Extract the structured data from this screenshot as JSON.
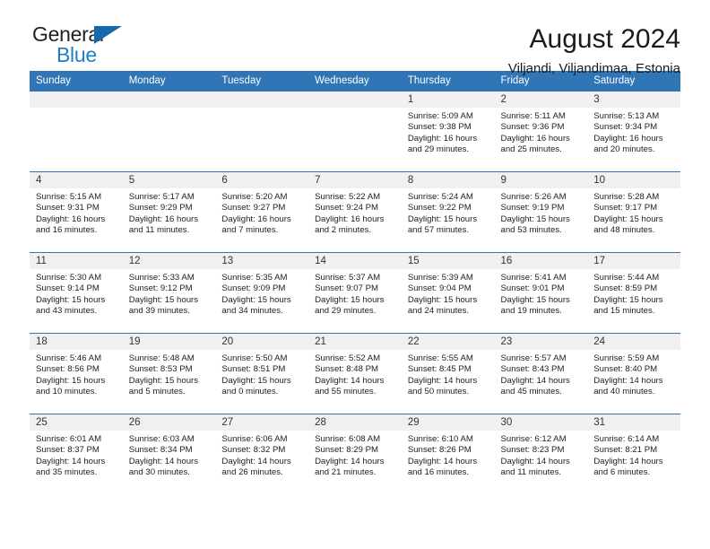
{
  "brand": {
    "name_dark": "General",
    "name_blue": "Blue",
    "accent_color": "#1f7fc6",
    "triangle_color": "#1668ad"
  },
  "header": {
    "title": "August 2024",
    "subtitle": "Viljandi, Viljandimaa, Estonia",
    "header_bg": "#3075b5",
    "daynum_bg": "#f0f0f0"
  },
  "weekday_headers": [
    "Sunday",
    "Monday",
    "Tuesday",
    "Wednesday",
    "Thursday",
    "Friday",
    "Saturday"
  ],
  "labels": {
    "sunrise": "Sunrise:",
    "sunset": "Sunset:",
    "daylight": "Daylight:"
  },
  "weeks": [
    [
      {
        "day": "",
        "empty": true,
        "sunrise": "",
        "sunset": "",
        "daylight1": "",
        "daylight2": ""
      },
      {
        "day": "",
        "empty": true,
        "sunrise": "",
        "sunset": "",
        "daylight1": "",
        "daylight2": ""
      },
      {
        "day": "",
        "empty": true,
        "sunrise": "",
        "sunset": "",
        "daylight1": "",
        "daylight2": ""
      },
      {
        "day": "",
        "empty": true,
        "sunrise": "",
        "sunset": "",
        "daylight1": "",
        "daylight2": ""
      },
      {
        "day": "1",
        "sunrise": "Sunrise: 5:09 AM",
        "sunset": "Sunset: 9:38 PM",
        "daylight1": "Daylight: 16 hours",
        "daylight2": "and 29 minutes."
      },
      {
        "day": "2",
        "sunrise": "Sunrise: 5:11 AM",
        "sunset": "Sunset: 9:36 PM",
        "daylight1": "Daylight: 16 hours",
        "daylight2": "and 25 minutes."
      },
      {
        "day": "3",
        "sunrise": "Sunrise: 5:13 AM",
        "sunset": "Sunset: 9:34 PM",
        "daylight1": "Daylight: 16 hours",
        "daylight2": "and 20 minutes."
      }
    ],
    [
      {
        "day": "4",
        "sunrise": "Sunrise: 5:15 AM",
        "sunset": "Sunset: 9:31 PM",
        "daylight1": "Daylight: 16 hours",
        "daylight2": "and 16 minutes."
      },
      {
        "day": "5",
        "sunrise": "Sunrise: 5:17 AM",
        "sunset": "Sunset: 9:29 PM",
        "daylight1": "Daylight: 16 hours",
        "daylight2": "and 11 minutes."
      },
      {
        "day": "6",
        "sunrise": "Sunrise: 5:20 AM",
        "sunset": "Sunset: 9:27 PM",
        "daylight1": "Daylight: 16 hours",
        "daylight2": "and 7 minutes."
      },
      {
        "day": "7",
        "sunrise": "Sunrise: 5:22 AM",
        "sunset": "Sunset: 9:24 PM",
        "daylight1": "Daylight: 16 hours",
        "daylight2": "and 2 minutes."
      },
      {
        "day": "8",
        "sunrise": "Sunrise: 5:24 AM",
        "sunset": "Sunset: 9:22 PM",
        "daylight1": "Daylight: 15 hours",
        "daylight2": "and 57 minutes."
      },
      {
        "day": "9",
        "sunrise": "Sunrise: 5:26 AM",
        "sunset": "Sunset: 9:19 PM",
        "daylight1": "Daylight: 15 hours",
        "daylight2": "and 53 minutes."
      },
      {
        "day": "10",
        "sunrise": "Sunrise: 5:28 AM",
        "sunset": "Sunset: 9:17 PM",
        "daylight1": "Daylight: 15 hours",
        "daylight2": "and 48 minutes."
      }
    ],
    [
      {
        "day": "11",
        "sunrise": "Sunrise: 5:30 AM",
        "sunset": "Sunset: 9:14 PM",
        "daylight1": "Daylight: 15 hours",
        "daylight2": "and 43 minutes."
      },
      {
        "day": "12",
        "sunrise": "Sunrise: 5:33 AM",
        "sunset": "Sunset: 9:12 PM",
        "daylight1": "Daylight: 15 hours",
        "daylight2": "and 39 minutes."
      },
      {
        "day": "13",
        "sunrise": "Sunrise: 5:35 AM",
        "sunset": "Sunset: 9:09 PM",
        "daylight1": "Daylight: 15 hours",
        "daylight2": "and 34 minutes."
      },
      {
        "day": "14",
        "sunrise": "Sunrise: 5:37 AM",
        "sunset": "Sunset: 9:07 PM",
        "daylight1": "Daylight: 15 hours",
        "daylight2": "and 29 minutes."
      },
      {
        "day": "15",
        "sunrise": "Sunrise: 5:39 AM",
        "sunset": "Sunset: 9:04 PM",
        "daylight1": "Daylight: 15 hours",
        "daylight2": "and 24 minutes."
      },
      {
        "day": "16",
        "sunrise": "Sunrise: 5:41 AM",
        "sunset": "Sunset: 9:01 PM",
        "daylight1": "Daylight: 15 hours",
        "daylight2": "and 19 minutes."
      },
      {
        "day": "17",
        "sunrise": "Sunrise: 5:44 AM",
        "sunset": "Sunset: 8:59 PM",
        "daylight1": "Daylight: 15 hours",
        "daylight2": "and 15 minutes."
      }
    ],
    [
      {
        "day": "18",
        "sunrise": "Sunrise: 5:46 AM",
        "sunset": "Sunset: 8:56 PM",
        "daylight1": "Daylight: 15 hours",
        "daylight2": "and 10 minutes."
      },
      {
        "day": "19",
        "sunrise": "Sunrise: 5:48 AM",
        "sunset": "Sunset: 8:53 PM",
        "daylight1": "Daylight: 15 hours",
        "daylight2": "and 5 minutes."
      },
      {
        "day": "20",
        "sunrise": "Sunrise: 5:50 AM",
        "sunset": "Sunset: 8:51 PM",
        "daylight1": "Daylight: 15 hours",
        "daylight2": "and 0 minutes."
      },
      {
        "day": "21",
        "sunrise": "Sunrise: 5:52 AM",
        "sunset": "Sunset: 8:48 PM",
        "daylight1": "Daylight: 14 hours",
        "daylight2": "and 55 minutes."
      },
      {
        "day": "22",
        "sunrise": "Sunrise: 5:55 AM",
        "sunset": "Sunset: 8:45 PM",
        "daylight1": "Daylight: 14 hours",
        "daylight2": "and 50 minutes."
      },
      {
        "day": "23",
        "sunrise": "Sunrise: 5:57 AM",
        "sunset": "Sunset: 8:43 PM",
        "daylight1": "Daylight: 14 hours",
        "daylight2": "and 45 minutes."
      },
      {
        "day": "24",
        "sunrise": "Sunrise: 5:59 AM",
        "sunset": "Sunset: 8:40 PM",
        "daylight1": "Daylight: 14 hours",
        "daylight2": "and 40 minutes."
      }
    ],
    [
      {
        "day": "25",
        "sunrise": "Sunrise: 6:01 AM",
        "sunset": "Sunset: 8:37 PM",
        "daylight1": "Daylight: 14 hours",
        "daylight2": "and 35 minutes."
      },
      {
        "day": "26",
        "sunrise": "Sunrise: 6:03 AM",
        "sunset": "Sunset: 8:34 PM",
        "daylight1": "Daylight: 14 hours",
        "daylight2": "and 30 minutes."
      },
      {
        "day": "27",
        "sunrise": "Sunrise: 6:06 AM",
        "sunset": "Sunset: 8:32 PM",
        "daylight1": "Daylight: 14 hours",
        "daylight2": "and 26 minutes."
      },
      {
        "day": "28",
        "sunrise": "Sunrise: 6:08 AM",
        "sunset": "Sunset: 8:29 PM",
        "daylight1": "Daylight: 14 hours",
        "daylight2": "and 21 minutes."
      },
      {
        "day": "29",
        "sunrise": "Sunrise: 6:10 AM",
        "sunset": "Sunset: 8:26 PM",
        "daylight1": "Daylight: 14 hours",
        "daylight2": "and 16 minutes."
      },
      {
        "day": "30",
        "sunrise": "Sunrise: 6:12 AM",
        "sunset": "Sunset: 8:23 PM",
        "daylight1": "Daylight: 14 hours",
        "daylight2": "and 11 minutes."
      },
      {
        "day": "31",
        "sunrise": "Sunrise: 6:14 AM",
        "sunset": "Sunset: 8:21 PM",
        "daylight1": "Daylight: 14 hours",
        "daylight2": "and 6 minutes."
      }
    ]
  ]
}
